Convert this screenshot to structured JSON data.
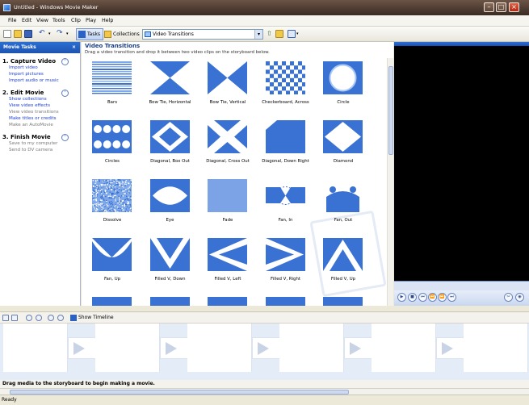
{
  "window": {
    "title": "Untitled - Windows Movie Maker"
  },
  "menu": [
    "File",
    "Edit",
    "View",
    "Tools",
    "Clip",
    "Play",
    "Help"
  ],
  "toolbar": {
    "tasks_label": "Tasks",
    "collections_label": "Collections",
    "collection_select_value": "Video Transitions"
  },
  "taskpane": {
    "title": "Movie Tasks",
    "sections": [
      {
        "heading": "1. Capture Video",
        "links": [
          "Import video",
          "Import pictures",
          "Import audio or music"
        ]
      },
      {
        "heading": "2. Edit Movie",
        "links": [
          "Show collections",
          "View video effects",
          "View video transitions",
          "Make titles or credits",
          "Make an AutoMovie"
        ]
      },
      {
        "heading": "3. Finish Movie",
        "links": [
          "Save to my computer",
          "Send to DV camera"
        ]
      }
    ]
  },
  "content": {
    "title": "Video Transitions",
    "subtitle": "Drag a video transition and drop it between two video clips on the storyboard below.",
    "transitions": [
      "Bars",
      "Bow Tie, Horizontal",
      "Bow Tie, Vertical",
      "Checkerboard, Across",
      "Circle",
      "Circles",
      "Diagonal, Box Out",
      "Diagonal, Cross Out",
      "Diagonal, Down Right",
      "Diamond",
      "Dissolve",
      "Eye",
      "Fade",
      "Fan, In",
      "Fan, Out",
      "Fan, Up",
      "Filled V, Down",
      "Filled V, Left",
      "Filled V, Right",
      "Filled V, Up"
    ]
  },
  "storyboard": {
    "show_timeline_label": "Show Timeline",
    "hint": "Drag media to the storyboard to begin making a movie."
  },
  "status": {
    "text": "Ready"
  },
  "colors": {
    "accent": "#3a72d4",
    "accent_light": "#a9c8f5",
    "title_bar": "#4d3b31"
  }
}
